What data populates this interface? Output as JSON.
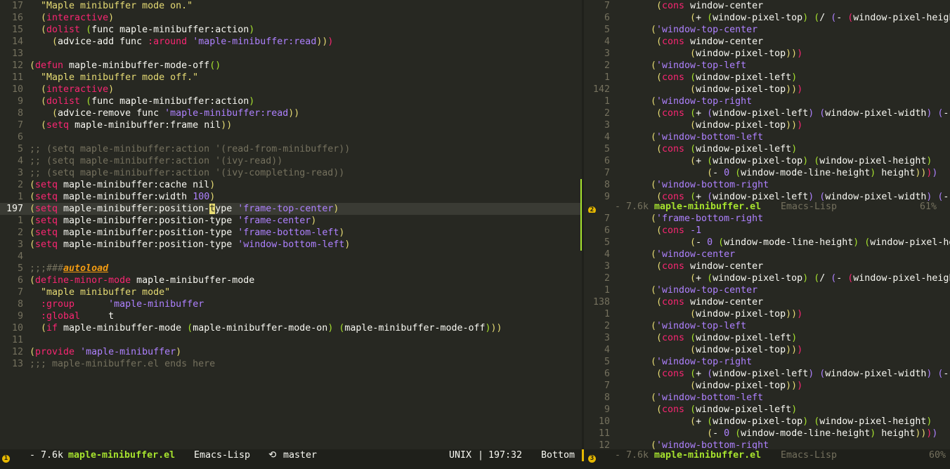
{
  "colors": {
    "bg": "#272822",
    "text": "#f8f8f2",
    "linenum": "#75715e",
    "string": "#e6db74",
    "keyword": "#f92672",
    "function": "#a6e22e",
    "symbol": "#ae81ff",
    "comment": "#75715e",
    "cursor": "#e6db74",
    "accent": "#a6e22e"
  },
  "left": {
    "lines": [
      {
        "n": "17",
        "code": "  \"Maple minibuffer mode on.\""
      },
      {
        "n": "16",
        "code": "  (interactive)"
      },
      {
        "n": "15",
        "code": "  (dolist (func maple-minibuffer:action)"
      },
      {
        "n": "14",
        "code": "    (advice-add func :around 'maple-minibuffer:read)))"
      },
      {
        "n": "13",
        "code": ""
      },
      {
        "n": "12",
        "code": "(defun maple-minibuffer-mode-off()"
      },
      {
        "n": "11",
        "code": "  \"Maple minibuffer mode off.\""
      },
      {
        "n": "10",
        "code": "  (interactive)"
      },
      {
        "n": "9",
        "code": "  (dolist (func maple-minibuffer:action)"
      },
      {
        "n": "8",
        "code": "    (advice-remove func 'maple-minibuffer:read))"
      },
      {
        "n": "7",
        "code": "  (setq maple-minibuffer:frame nil))"
      },
      {
        "n": "6",
        "code": ""
      },
      {
        "n": "5",
        "code": ";; (setq maple-minibuffer:action '(read-from-minibuffer))"
      },
      {
        "n": "4",
        "code": ";; (setq maple-minibuffer:action '(ivy-read))"
      },
      {
        "n": "3",
        "code": ";; (setq maple-minibuffer:action '(ivy-completing-read))"
      },
      {
        "n": "2",
        "code": "(setq maple-minibuffer:cache nil)"
      },
      {
        "n": "1",
        "code": "(setq maple-minibuffer:width 100)"
      },
      {
        "n": "197",
        "code": "(setq maple-minibuffer:position-type 'frame-top-center)"
      },
      {
        "n": "1",
        "code": "(setq maple-minibuffer:position-type 'frame-center)"
      },
      {
        "n": "2",
        "code": "(setq maple-minibuffer:position-type 'frame-bottom-left)"
      },
      {
        "n": "3",
        "code": "(setq maple-minibuffer:position-type 'window-bottom-left)"
      },
      {
        "n": "4",
        "code": ""
      },
      {
        "n": "5",
        "code": ";;;###autoload"
      },
      {
        "n": "6",
        "code": "(define-minor-mode maple-minibuffer-mode"
      },
      {
        "n": "7",
        "code": "  \"maple minibuffer mode\""
      },
      {
        "n": "8",
        "code": "  :group      'maple-minibuffer"
      },
      {
        "n": "9",
        "code": "  :global     t"
      },
      {
        "n": "10",
        "code": "  (if maple-minibuffer-mode (maple-minibuffer-mode-on) (maple-minibuffer-mode-off)))"
      },
      {
        "n": "11",
        "code": ""
      },
      {
        "n": "12",
        "code": "(provide 'maple-minibuffer)"
      },
      {
        "n": "13",
        "code": ";;; maple-minibuffer.el ends here"
      }
    ],
    "current_line": 17,
    "cursor_col": 32
  },
  "right_top": {
    "lines": [
      {
        "n": "7",
        "code": " (cons window-center"
      },
      {
        "n": "6",
        "code": "       (+ (window-pixel-top) (/ (- (window-pixel-heigh"
      },
      {
        "n": "5",
        "code": "('window-top-center"
      },
      {
        "n": "4",
        "code": " (cons window-center"
      },
      {
        "n": "3",
        "code": "       (window-pixel-top)))"
      },
      {
        "n": "2",
        "code": "('window-top-left"
      },
      {
        "n": "1",
        "code": " (cons (window-pixel-left)"
      },
      {
        "n": "142",
        "code": "       (window-pixel-top)))"
      },
      {
        "n": "1",
        "code": "('window-top-right"
      },
      {
        "n": "2",
        "code": " (cons (+ (window-pixel-left) (window-pixel-width) (-"
      },
      {
        "n": "3",
        "code": "       (window-pixel-top)))"
      },
      {
        "n": "4",
        "code": "('window-bottom-left"
      },
      {
        "n": "5",
        "code": " (cons (window-pixel-left)"
      },
      {
        "n": "6",
        "code": "       (+ (window-pixel-top) (window-pixel-height)"
      },
      {
        "n": "7",
        "code": "          (- 0 (window-mode-line-height) height))))"
      },
      {
        "n": "8",
        "code": "('window-bottom-right"
      },
      {
        "n": "9",
        "code": " (cons (+ (window-pixel-left) (window-pixel-width) (-"
      }
    ]
  },
  "right_bottom": {
    "lines": [
      {
        "n": "7",
        "code": "('frame-bottom-right"
      },
      {
        "n": "6",
        "code": " (cons -1"
      },
      {
        "n": "5",
        "code": "       (- 0 (window-mode-line-height) (window-pixel-he"
      },
      {
        "n": "4",
        "code": "('window-center"
      },
      {
        "n": "3",
        "code": " (cons window-center"
      },
      {
        "n": "2",
        "code": "       (+ (window-pixel-top) (/ (- (window-pixel-heigh"
      },
      {
        "n": "1",
        "code": "('window-top-center"
      },
      {
        "n": "138",
        "code": " (cons window-center"
      },
      {
        "n": "1",
        "code": "       (window-pixel-top)))"
      },
      {
        "n": "2",
        "code": "('window-top-left"
      },
      {
        "n": "3",
        "code": " (cons (window-pixel-left)"
      },
      {
        "n": "4",
        "code": "       (window-pixel-top)))"
      },
      {
        "n": "5",
        "code": "('window-top-right"
      },
      {
        "n": "6",
        "code": " (cons (+ (window-pixel-left) (window-pixel-width) (-"
      },
      {
        "n": "7",
        "code": "       (window-pixel-top)))"
      },
      {
        "n": "8",
        "code": "('window-bottom-left"
      },
      {
        "n": "9",
        "code": " (cons (window-pixel-left)"
      },
      {
        "n": "10",
        "code": "       (+ (window-pixel-top) (window-pixel-height)"
      },
      {
        "n": "11",
        "code": "          (- 0 (window-mode-line-height) height))))"
      },
      {
        "n": "12",
        "code": "('window-bottom-right"
      }
    ]
  },
  "modeline_top": {
    "badge": "2",
    "state": "- 7.6k",
    "filename": "maple-minibuffer.el",
    "mode": "Emacs-Lisp",
    "percent": "61%"
  },
  "modeline_bottom": {
    "left_badge": "1",
    "state": "- 7.6k",
    "filename": "maple-minibuffer.el",
    "mode": "Emacs-Lisp",
    "vcs_icon": "branch-icon",
    "vcs_glyph": "⟲",
    "branch": "master",
    "encoding": "UNIX",
    "separator": "|",
    "position": "197:32",
    "scroll": "Bottom",
    "right_badge": "3",
    "right_state": "- 7.6k",
    "right_filename": "maple-minibuffer.el",
    "right_mode": "Emacs-Lisp",
    "right_percent": "60%"
  }
}
